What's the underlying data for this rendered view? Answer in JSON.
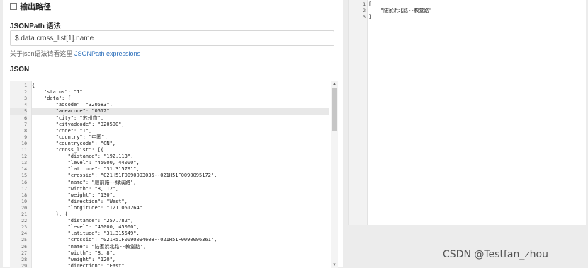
{
  "options": {
    "output_path_label": "输出路径"
  },
  "jsonpath": {
    "title": "JSONPath 语法",
    "value": "$.data.cross_list[1].name",
    "hint_prefix": "关于json语法请看这里",
    "hint_link": "JSONPath expressions"
  },
  "json_title": "JSON",
  "editor": {
    "lines": [
      "{",
      "    \"status\": \"1\",",
      "    \"data\": {",
      "        \"adcode\": \"320583\",",
      "        \"areacode\": \"0512\",",
      "        \"city\": \"苏州市\",",
      "        \"cityadcode\": \"320500\",",
      "        \"code\": \"1\",",
      "        \"country\": \"中国\",",
      "        \"countrycode\": \"CN\",",
      "        \"cross_list\": [{",
      "            \"distance\": \"192.113\",",
      "            \"level\": \"45000, 44000\",",
      "            \"latitude\": \"31.315791\",",
      "            \"crossid\": \"021H51F0090093035--021H51F0090095172\",",
      "            \"name\": \"顺前路--绿溪路\",",
      "            \"width\": \"8, 12\",",
      "            \"weight\": \"130\",",
      "            \"direction\": \"West\",",
      "            \"longitude\": \"121.051264\"",
      "        }, {",
      "            \"distance\": \"257.782\",",
      "            \"level\": \"45000, 45000\",",
      "            \"latitude\": \"31.315549\",",
      "            \"crossid\": \"021H51F0090094608--021H51F0090096361\",",
      "            \"name\": \"陆家浜北路--教堂路\",",
      "            \"width\": \"8, 8\",",
      "            \"weight\": \"120\",",
      "            \"direction\": \"East\""
    ],
    "scroll_up": "▲",
    "scroll_down": "▼"
  },
  "result": {
    "lines": [
      "[",
      "    \"陆家浜北路--教堂路\"",
      "]"
    ]
  },
  "watermark": "CSDN @Testfan_zhou"
}
